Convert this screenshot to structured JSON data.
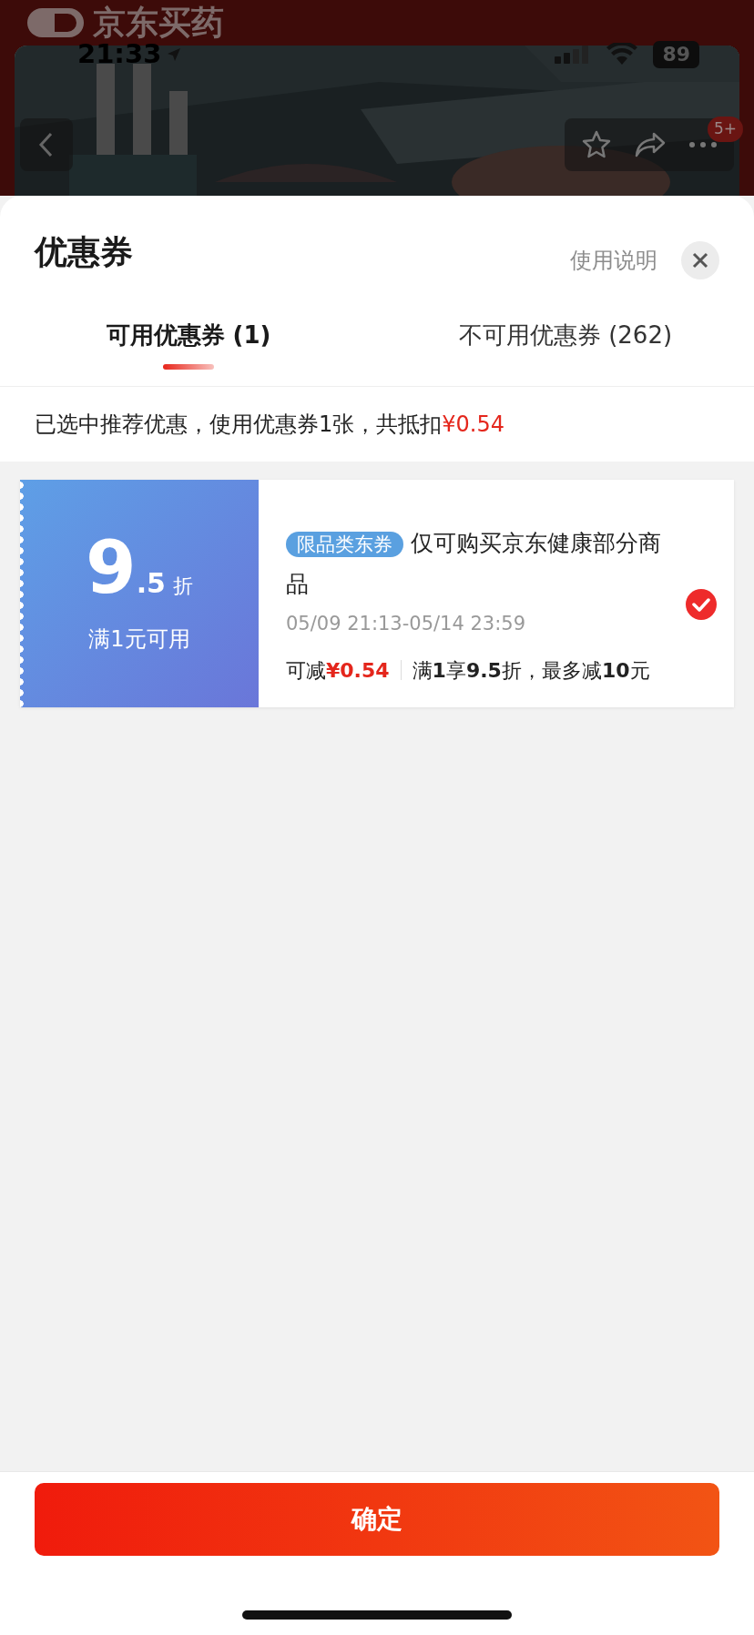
{
  "app_header": {
    "brand": "京东买药"
  },
  "status_bar": {
    "time": "21:33",
    "battery": "89"
  },
  "product_nav": {
    "badge": "5+"
  },
  "sheet": {
    "title": "优惠券",
    "help_link": "使用说明"
  },
  "tabs": [
    {
      "label": "可用优惠券 (1)",
      "selected": true
    },
    {
      "label": "不可用优惠券 (262)",
      "selected": false
    }
  ],
  "summary": {
    "text": "已选中推荐优惠，使用优惠券1张，共抵扣",
    "amount": "¥0.54"
  },
  "coupons": [
    {
      "value_int": "9",
      "value_dec": ".5",
      "unit": "折",
      "threshold": "满1元可用",
      "tag": "限品类东券",
      "description": "仅可购买京东健康部分商品",
      "validity": "05/09 21:13-05/14 23:59",
      "saving_label": "可减",
      "saving": "¥0.54",
      "rule": "满**1**享**9.5**折，最多减**10**元",
      "selected": true
    }
  ],
  "confirm_button": "确定"
}
